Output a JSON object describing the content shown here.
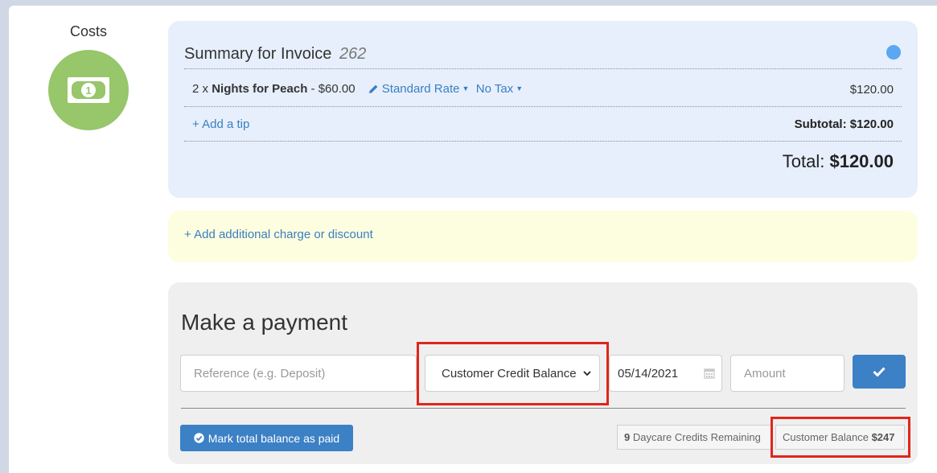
{
  "sidebar": {
    "costs_title": "Costs",
    "costs_icon": "dollar-bill-icon",
    "costs_icon_color": "#97c66b"
  },
  "summary": {
    "title": "Summary for Invoice",
    "invoice_number": "262",
    "status_dot_color": "#5aa7f2",
    "line_item": {
      "quantity": "2 x",
      "name": "Nights for Peach",
      "unit_price": "- $60.00",
      "rate_label": "Standard Rate",
      "tax_label": "No Tax",
      "total": "$120.00"
    },
    "add_tip_label": "+ Add a tip",
    "subtotal": "Subtotal: $120.00",
    "total_label": "Total:",
    "total_value": "$120.00"
  },
  "additional": {
    "add_charge_label": "+ Add additional charge or discount"
  },
  "payment": {
    "title": "Make a payment",
    "reference_placeholder": "Reference (e.g. Deposit)",
    "method_selected": "Customer Credit Balance",
    "date_value": "05/14/2021",
    "amount_placeholder": "Amount",
    "mark_paid_label": "Mark total balance as paid",
    "credits_count": "9",
    "credits_label": "Daycare Credits Remaining",
    "balance_label": "Customer Balance",
    "balance_value": "$247"
  },
  "colors": {
    "link": "#3a7fc1",
    "primary_button": "#3c80c6",
    "highlight": "#e0261a"
  }
}
